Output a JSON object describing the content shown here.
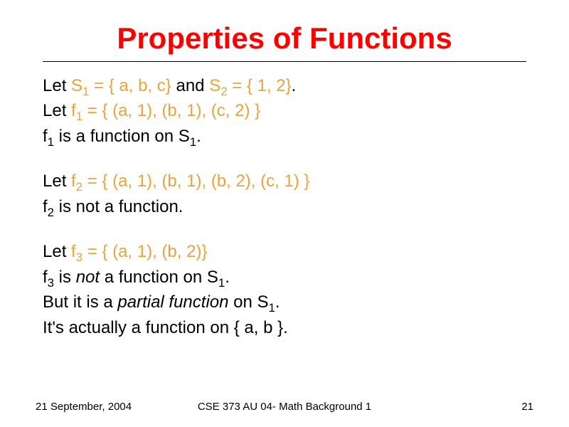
{
  "title": "Properties of Functions",
  "block1": {
    "l1a": "Let ",
    "l1b": "S",
    "l1sub": "1",
    "l1c": " = { a, b, c}",
    "l1d": " and ",
    "l1e": "S",
    "l1sub2": "2",
    "l1f": " = { 1, 2}",
    "l1g": ".",
    "l2a": "Let ",
    "l2b": "f",
    "l2sub": "1",
    "l2c": " = { (a, 1), (b, 1), (c, 2) }",
    "l3a": "f",
    "l3sub": "1",
    "l3b": " is a function on S",
    "l3sub2": "1",
    "l3c": "."
  },
  "block2": {
    "l1a": "Let ",
    "l1b": "f",
    "l1sub": "2",
    "l1c": " = { (a, 1), (b, 1), (b, 2), (c, 1) }",
    "l2a": "f",
    "l2sub": "2",
    "l2b": " is not a function."
  },
  "block3": {
    "l1a": "Let ",
    "l1b": "f",
    "l1sub": "3",
    "l1c": " = { (a, 1), (b, 2)}",
    "l2a": "f",
    "l2sub": "3",
    "l2b": " is ",
    "l2c": "not",
    "l2d": " a function on S",
    "l2sub2": "1",
    "l2e": ".",
    "l3a": "But it is a ",
    "l3b": "partial function",
    "l3c": " on S",
    "l3sub": "1",
    "l3d": ".",
    "l4": "It's actually a function on { a, b }."
  },
  "footer": {
    "date": "21 September, 2004",
    "course": "CSE 373 AU 04- Math Background 1",
    "page": "21"
  }
}
